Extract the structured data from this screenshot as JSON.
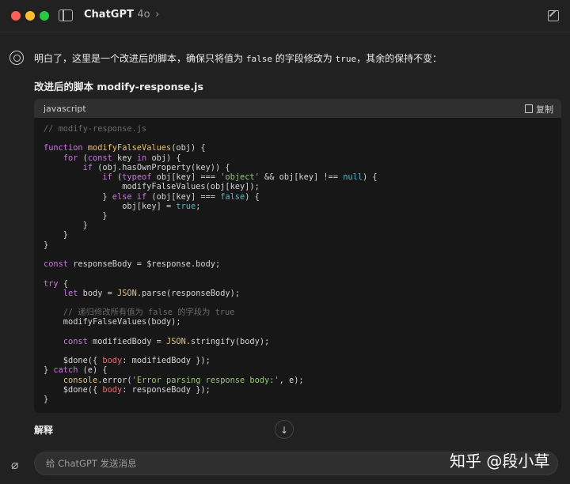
{
  "window": {
    "title": "ChatGPT",
    "version": "4o",
    "chevron": "›"
  },
  "message": {
    "intro_parts": [
      "明白了，这里是一个改进后的脚本，确保只将值为 ",
      "false",
      " 的字段修改为 ",
      "true",
      "，其余的保持不变："
    ],
    "subheading": "改进后的脚本 modify-response.js"
  },
  "code_block": {
    "language": "javascript",
    "copy_label": "复制",
    "lines": [
      [
        [
          "// modify-response.js",
          "cm"
        ]
      ],
      [],
      [
        [
          "function ",
          "kw"
        ],
        [
          "modifyFalseValues",
          "fn"
        ],
        [
          "(obj) {",
          ""
        ]
      ],
      [
        [
          "    ",
          ""
        ],
        [
          "for ",
          "kw"
        ],
        [
          "(",
          ""
        ],
        [
          "const ",
          "kw"
        ],
        [
          "key ",
          ""
        ],
        [
          "in ",
          "kw"
        ],
        [
          "obj) {",
          ""
        ]
      ],
      [
        [
          "        ",
          ""
        ],
        [
          "if ",
          "kw"
        ],
        [
          "(obj.hasOwnProperty(key)) {",
          ""
        ]
      ],
      [
        [
          "            ",
          ""
        ],
        [
          "if ",
          "kw"
        ],
        [
          "(",
          ""
        ],
        [
          "typeof ",
          "kw"
        ],
        [
          "obj[key] === ",
          ""
        ],
        [
          "'object'",
          "str"
        ],
        [
          " && obj[key] !== ",
          ""
        ],
        [
          "null",
          "lit"
        ],
        [
          ") {",
          ""
        ]
      ],
      [
        [
          "                modifyFalseValues(obj[key]);",
          ""
        ]
      ],
      [
        [
          "            } ",
          ""
        ],
        [
          "else if ",
          "kw"
        ],
        [
          "(obj[key] === ",
          ""
        ],
        [
          "false",
          "lit"
        ],
        [
          ") {",
          ""
        ]
      ],
      [
        [
          "                obj[key] = ",
          ""
        ],
        [
          "true",
          "lit"
        ],
        [
          ";",
          ""
        ]
      ],
      [
        [
          "            }",
          ""
        ]
      ],
      [
        [
          "        }",
          ""
        ]
      ],
      [
        [
          "    }",
          ""
        ]
      ],
      [
        [
          "}",
          ""
        ]
      ],
      [],
      [
        [
          "const ",
          "kw"
        ],
        [
          "responseBody = $response.body;",
          ""
        ]
      ],
      [],
      [
        [
          "try ",
          "kw"
        ],
        [
          "{",
          ""
        ]
      ],
      [
        [
          "    ",
          ""
        ],
        [
          "let ",
          "kw"
        ],
        [
          "body = ",
          ""
        ],
        [
          "JSON",
          "fn"
        ],
        [
          ".parse(responseBody);",
          ""
        ]
      ],
      [],
      [
        [
          "    ",
          ""
        ],
        [
          "// 递归修改所有值为 false 的字段为 true",
          "cm"
        ]
      ],
      [
        [
          "    modifyFalseValues(body);",
          ""
        ]
      ],
      [],
      [
        [
          "    ",
          ""
        ],
        [
          "const ",
          "kw"
        ],
        [
          "modifiedBody = ",
          ""
        ],
        [
          "JSON",
          "fn"
        ],
        [
          ".stringify(body);",
          ""
        ]
      ],
      [],
      [
        [
          "    $done({ ",
          ""
        ],
        [
          "body",
          "prop"
        ],
        [
          ": modifiedBody });",
          ""
        ]
      ],
      [
        [
          "} ",
          ""
        ],
        [
          "catch ",
          "kw"
        ],
        [
          "(e) {",
          ""
        ]
      ],
      [
        [
          "    ",
          ""
        ],
        [
          "console",
          "fn"
        ],
        [
          ".error(",
          ""
        ],
        [
          "'Error parsing response body:'",
          "str"
        ],
        [
          ", e);",
          ""
        ]
      ],
      [
        [
          "    $done({ ",
          ""
        ],
        [
          "body",
          "prop"
        ],
        [
          ": responseBody });",
          ""
        ]
      ],
      [
        [
          "}",
          ""
        ]
      ]
    ]
  },
  "explain_heading": "解释",
  "composer": {
    "placeholder": "给 ChatGPT 发送消息"
  },
  "watermark": "知乎 @段小草"
}
